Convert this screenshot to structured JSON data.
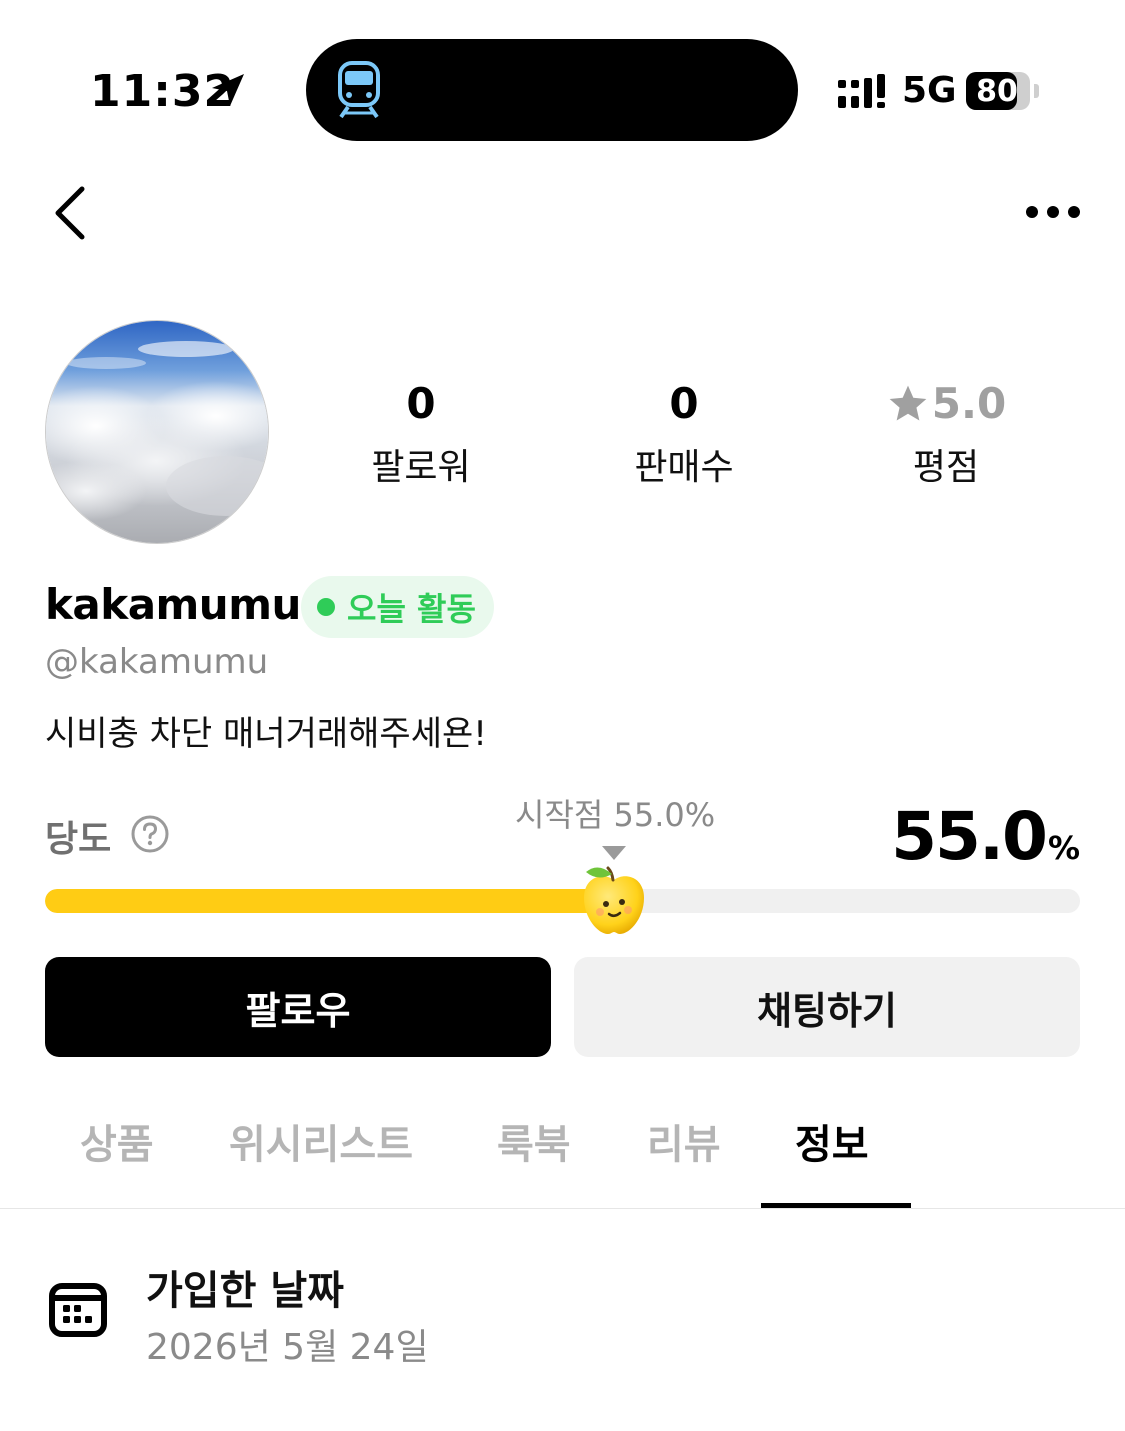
{
  "status_bar": {
    "time": "11:32",
    "network": "5G",
    "battery": "80",
    "battery_level": 0.8,
    "icons": [
      "location-arrow-icon",
      "train-icon",
      "signal-icon",
      "battery-icon"
    ]
  },
  "nav": {
    "back_icon": "chevron-left-icon",
    "more_icon": "more-horizontal-icon"
  },
  "profile": {
    "avatar": "sky-clouds-photo",
    "stats": [
      {
        "value": "0",
        "label": "팔로워"
      },
      {
        "value": "0",
        "label": "판매수"
      },
      {
        "value": "5.0",
        "label": "평점"
      }
    ],
    "username": "kakamumu",
    "activity_badge": "오늘 활동",
    "handle": "@kakamumu",
    "bio": "시비충 차단 매너거래해주세욘!"
  },
  "sweetness": {
    "label": "당도",
    "start_label": "시작점 55.0%",
    "value": "55.0",
    "unit": "%",
    "level": 0.55
  },
  "actions": {
    "follow": "팔로우",
    "chat": "채팅하기"
  },
  "tabs": [
    {
      "label": "상품",
      "active": false
    },
    {
      "label": "위시리스트",
      "active": false
    },
    {
      "label": "룩북",
      "active": false
    },
    {
      "label": "리뷰",
      "active": false
    },
    {
      "label": "정보",
      "active": true
    }
  ],
  "info": {
    "title": "가입한 날짜",
    "date": "2026년 5월 24일"
  },
  "colors": {
    "accent_yellow": "#ffcc14",
    "active_green": "#2fcc58",
    "badge_bg": "#e9f9ed"
  }
}
